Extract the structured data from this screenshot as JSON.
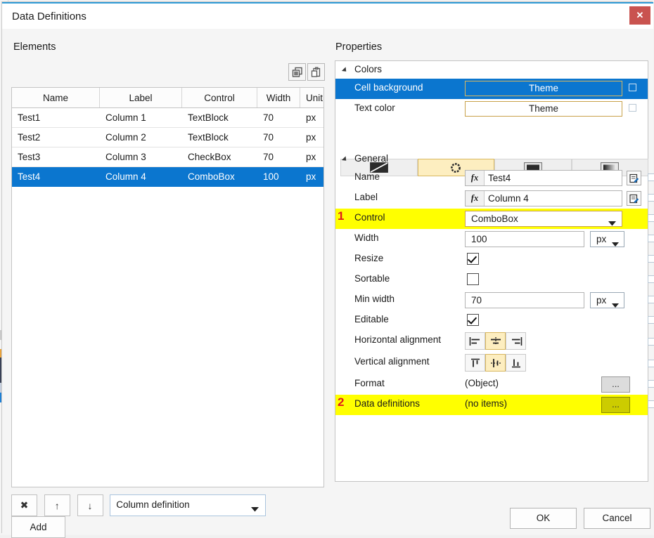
{
  "window": {
    "title": "Data Definitions",
    "close_label": "✕"
  },
  "left": {
    "section_label": "Elements",
    "icons": {
      "copy": "copy-icon",
      "paste": "paste-icon"
    },
    "grid": {
      "columns": [
        "Name",
        "Label",
        "Control",
        "Width",
        "Unit"
      ],
      "rows": [
        {
          "name": "Test1",
          "label": "Column 1",
          "control": "TextBlock",
          "width": "70",
          "unit": "px",
          "selected": false
        },
        {
          "name": "Test2",
          "label": "Column 2",
          "control": "TextBlock",
          "width": "70",
          "unit": "px",
          "selected": false
        },
        {
          "name": "Test3",
          "label": "Column 3",
          "control": "CheckBox",
          "width": "70",
          "unit": "px",
          "selected": false
        },
        {
          "name": "Test4",
          "label": "Column 4",
          "control": "ComboBox",
          "width": "100",
          "unit": "px",
          "selected": true
        }
      ]
    },
    "toolbar": {
      "delete_label": "✖",
      "move_up_label": "↑",
      "move_down_label": "↓",
      "type_selector_value": "Column definition",
      "add_label": "Add"
    }
  },
  "right": {
    "section_label": "Properties",
    "colors": {
      "header": "Colors",
      "cell_background": {
        "label": "Cell background",
        "value": "Theme"
      },
      "text_color": {
        "label": "Text color",
        "value": "Theme"
      },
      "modes": [
        {
          "name": "no-color",
          "active": false
        },
        {
          "name": "theme-color",
          "active": true
        },
        {
          "name": "solid-color",
          "active": false
        },
        {
          "name": "gradient-color",
          "active": false
        }
      ]
    },
    "general": {
      "header": "General",
      "name": {
        "label": "Name",
        "value": "Test4",
        "fx": "fx"
      },
      "label": {
        "label": "Label",
        "value": "Column 4",
        "fx": "fx"
      },
      "control": {
        "label": "Control",
        "value": "ComboBox",
        "annotation": "1"
      },
      "width": {
        "label": "Width",
        "value": "100",
        "unit": "px"
      },
      "resize": {
        "label": "Resize",
        "checked": true
      },
      "sortable": {
        "label": "Sortable",
        "checked": false
      },
      "min_width": {
        "label": "Min width",
        "value": "70",
        "unit": "px"
      },
      "editable": {
        "label": "Editable",
        "checked": true
      },
      "horizontal_alignment": {
        "label": "Horizontal alignment",
        "selected": 1
      },
      "vertical_alignment": {
        "label": "Vertical alignment",
        "selected": 1
      },
      "format": {
        "label": "Format",
        "value": "(Object)",
        "button": "..."
      },
      "data_definitions": {
        "label": "Data definitions",
        "value": "(no items)",
        "button": "...",
        "annotation": "2"
      }
    }
  },
  "footer": {
    "ok_label": "OK",
    "cancel_label": "Cancel"
  },
  "background": {
    "cut_text": ""
  },
  "colors": {
    "accent": "#2e9bd6",
    "selection": "#0b76cf",
    "highlight": "#ffff00",
    "annotation": "#e01b1b",
    "close": "#c9534f",
    "olive_button": "#cccc00"
  }
}
